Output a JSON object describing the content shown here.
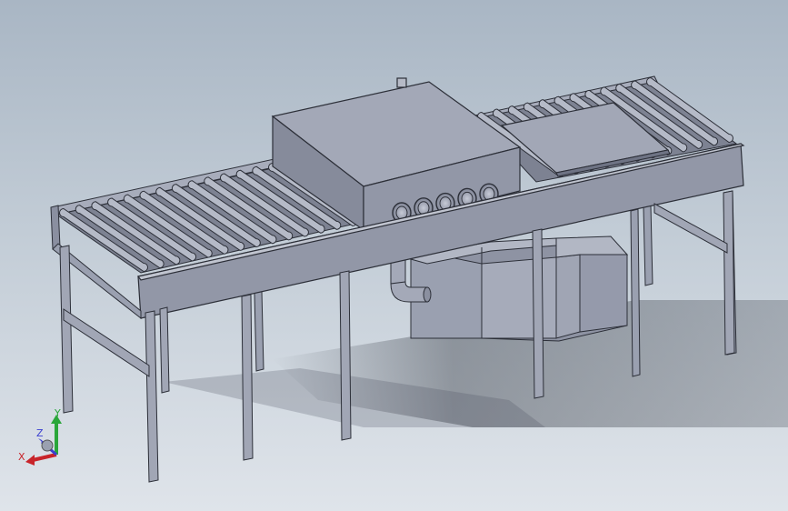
{
  "viewport": {
    "background_top": "#a9b6c4",
    "background_bottom": "#dfe4ea"
  },
  "model": {
    "part_color": "#9da2b2",
    "edge_color": "#2c2f38",
    "components": [
      "roller-conveyor-left",
      "roller-conveyor-right",
      "washing-chamber",
      "nozzle-row",
      "pump-tank",
      "drain-pipe",
      "support-legs",
      "workpiece-plate"
    ]
  },
  "triad": {
    "x_label": "X",
    "y_label": "Y",
    "z_label": "Z",
    "x_color": "#c8242a",
    "y_color": "#2aa63a",
    "z_color": "#3a3fd0"
  }
}
